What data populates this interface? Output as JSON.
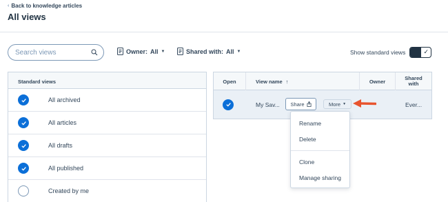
{
  "header": {
    "back_label": "Back to knowledge articles",
    "title": "All views"
  },
  "toolbar": {
    "search_placeholder": "Search views",
    "owner_label": "Owner:",
    "owner_value": "All",
    "shared_label": "Shared with:",
    "shared_value": "All",
    "show_standard_label": "Show standard views",
    "show_standard_on": true
  },
  "standard_views": {
    "heading": "Standard views",
    "items": [
      {
        "label": "All archived",
        "selected": true
      },
      {
        "label": "All articles",
        "selected": true
      },
      {
        "label": "All drafts",
        "selected": true
      },
      {
        "label": "All published",
        "selected": true
      },
      {
        "label": "Created by me",
        "selected": false
      }
    ]
  },
  "views_table": {
    "columns": [
      "Open",
      "View name",
      "Owner",
      "Shared with"
    ],
    "sort_indicator": "↑",
    "rows": [
      {
        "view_name": "My Sav...",
        "owner": "",
        "shared_with": "Ever...",
        "share_label": "Share",
        "more_label": "More"
      }
    ]
  },
  "more_menu": {
    "items": [
      "Rename",
      "Delete",
      "Clone",
      "Manage sharing"
    ]
  },
  "colors": {
    "accent_blue": "#0b6fd8",
    "annotation_arrow": "#e8542e",
    "text": "#33475b"
  }
}
